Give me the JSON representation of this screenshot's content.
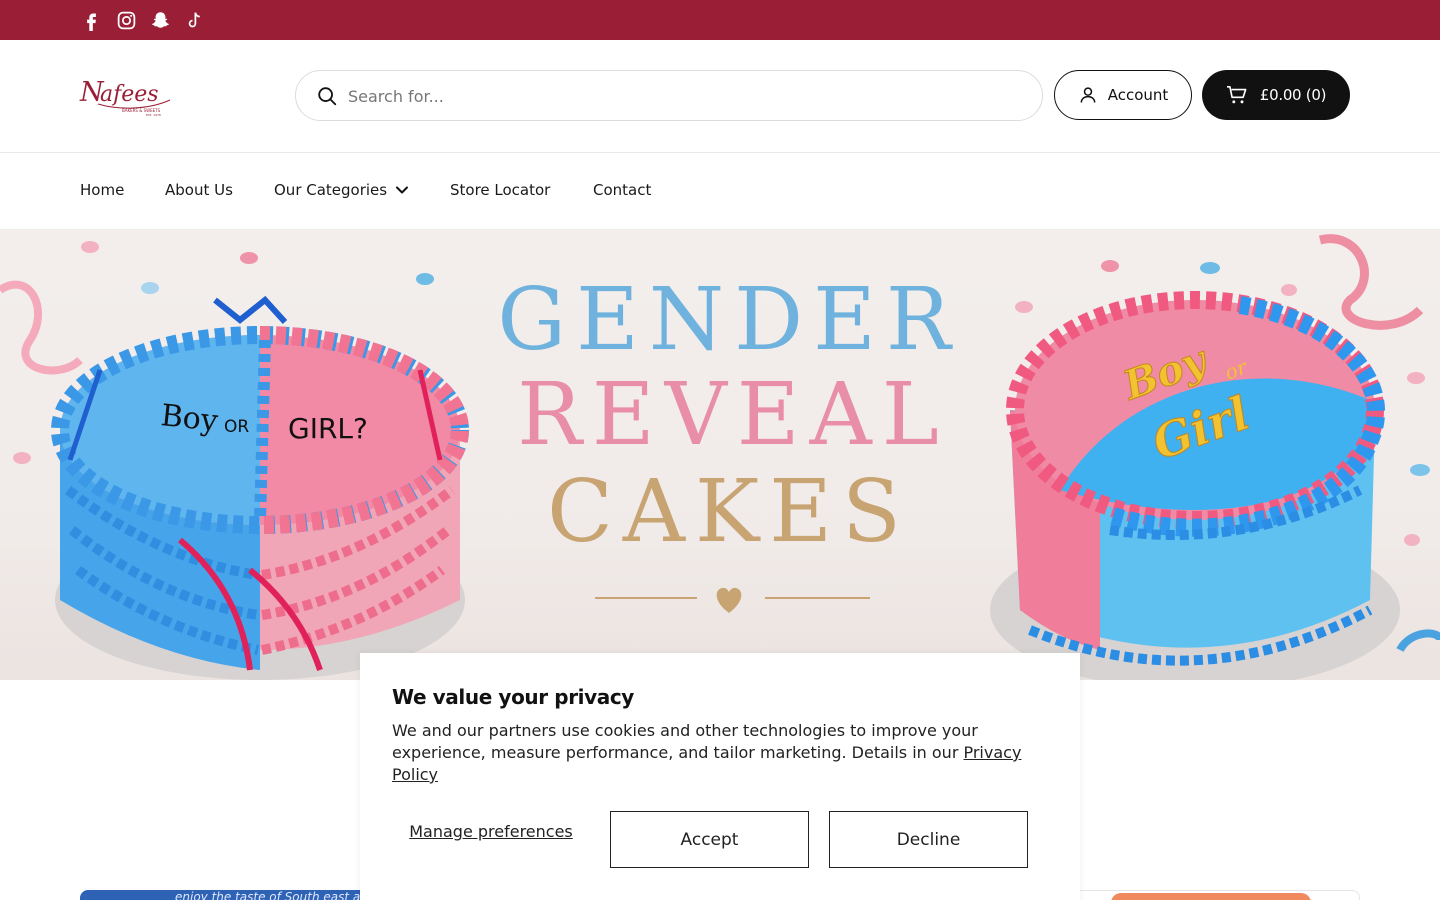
{
  "social": [
    {
      "name": "Facebook",
      "icon": "facebook-icon"
    },
    {
      "name": "Instagram",
      "icon": "instagram-icon"
    },
    {
      "name": "Snapchat",
      "icon": "snapchat-icon"
    },
    {
      "name": "TikTok",
      "icon": "tiktok-icon"
    }
  ],
  "brand": {
    "logo_text": "Nafees",
    "logo_sub": "BAKERS & SWEETS",
    "color": "#9a1f36"
  },
  "search": {
    "placeholder": "Search for..."
  },
  "header": {
    "account_label": "Account",
    "cart_label": "£0.00 (0)"
  },
  "nav": {
    "items": [
      {
        "label": "Home"
      },
      {
        "label": "About Us"
      },
      {
        "label": "Our Categories",
        "has_dropdown": true
      },
      {
        "label": "Store Locator"
      },
      {
        "label": "Contact"
      }
    ]
  },
  "hero": {
    "line1": "GENDER",
    "line2": "REVEAL",
    "line3": "CAKES",
    "left_cake_text_1": "Boy",
    "left_cake_text_2": "OR",
    "left_cake_text_3": "GIRL?",
    "right_cake_text_1": "Boy",
    "right_cake_text_2": "or",
    "right_cake_text_3": "Girl",
    "colors": {
      "blue": "#6eb2dd",
      "pink": "#e98ea9",
      "gold": "#c8a472"
    }
  },
  "products": {
    "left_caption": "enjoy the taste of South east asia"
  },
  "cookie": {
    "title": "We value your privacy",
    "body": "We and our partners use cookies and other technologies to improve your experience, measure performance, and tailor marketing. Details in our ",
    "policy_link": "Privacy Policy",
    "manage": "Manage preferences",
    "accept": "Accept",
    "decline": "Decline"
  }
}
